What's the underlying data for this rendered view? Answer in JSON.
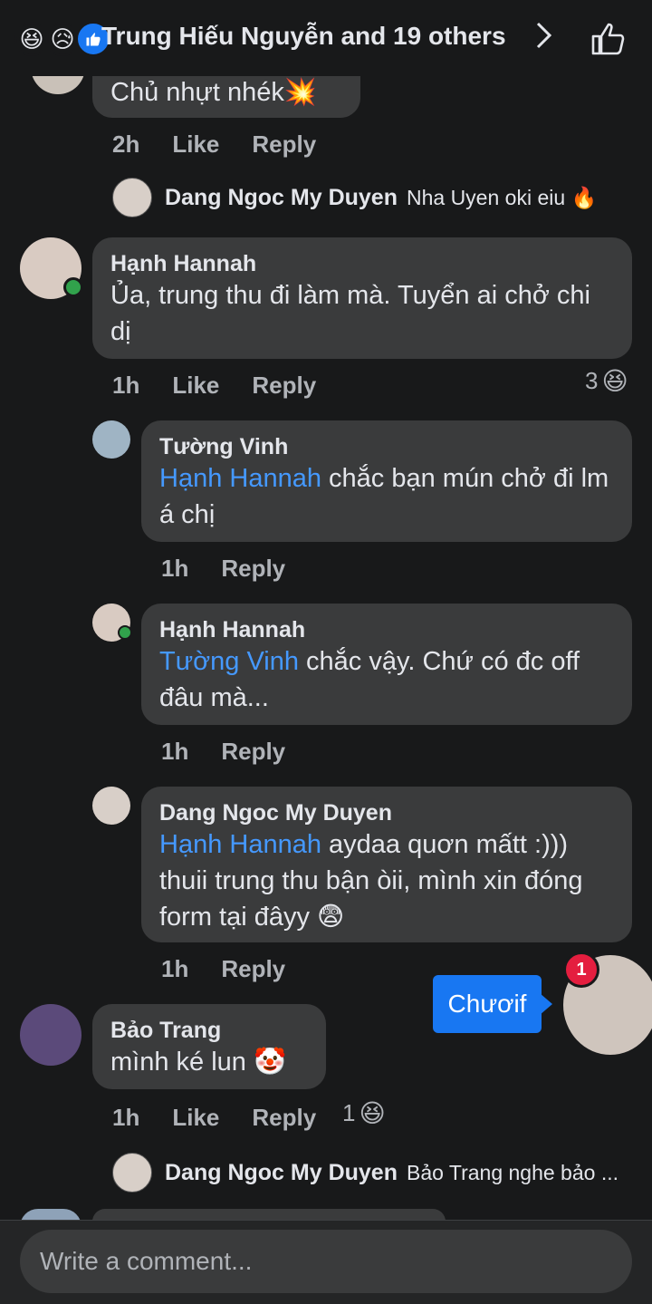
{
  "header": {
    "reaction_emojis": [
      "😆",
      "😥"
    ],
    "reactors_text": "Trung Hiếu Nguyễn and 19 others",
    "chevron_icon": "chevron-right-icon",
    "like_icon": "thumbs-up-icon"
  },
  "comments": [
    {
      "text": "Chủ nhựt nhék💥",
      "time": "2h",
      "like": "Like",
      "reply": "Reply",
      "reply_preview": {
        "name": "Dang Ngoc My Duyen",
        "text": "Nha Uyen oki eiu 🔥"
      }
    },
    {
      "name": "Hạnh Hannah",
      "text": "Ủa, trung thu đi làm mà. Tuyển ai chở chi dị",
      "time": "1h",
      "like": "Like",
      "reply": "Reply",
      "reaction_count": "3",
      "reaction_emoji": "😆",
      "replies": [
        {
          "name": "Tường Vinh",
          "mention": "Hạnh Hannah",
          "text": " chắc bạn mún chở đi lm á chị",
          "time": "1h",
          "reply": "Reply"
        },
        {
          "name": "Hạnh Hannah",
          "mention": "Tường Vinh",
          "text": " chắc vậy. Chứ có đc off đâu mà...",
          "time": "1h",
          "reply": "Reply"
        },
        {
          "name": "Dang Ngoc My Duyen",
          "mention": "Hạnh Hannah",
          "text": " aydaa quơn mấtt :))) thuii trung thu bận òii, mình xin đóng form tại đâyy 😨",
          "time": "1h",
          "reply": "Reply"
        }
      ]
    },
    {
      "name": "Bảo Trang",
      "text": "mình ké lun 🤡",
      "time": "1h",
      "like": "Like",
      "reply": "Reply",
      "reaction_count": "1",
      "reaction_emoji": "😆",
      "reply_preview": {
        "name": "Dang Ngoc My Duyen",
        "text": "Bảo Trang nghe bảo ..."
      }
    }
  ],
  "chathead": {
    "label": "Chươif",
    "badge": "1"
  },
  "composer": {
    "placeholder": "Write a comment..."
  },
  "colors": {
    "background": "#18191a",
    "bubble": "#3a3b3c",
    "mention": "#4599ff",
    "accent": "#1877f2",
    "online": "#31a24c"
  }
}
